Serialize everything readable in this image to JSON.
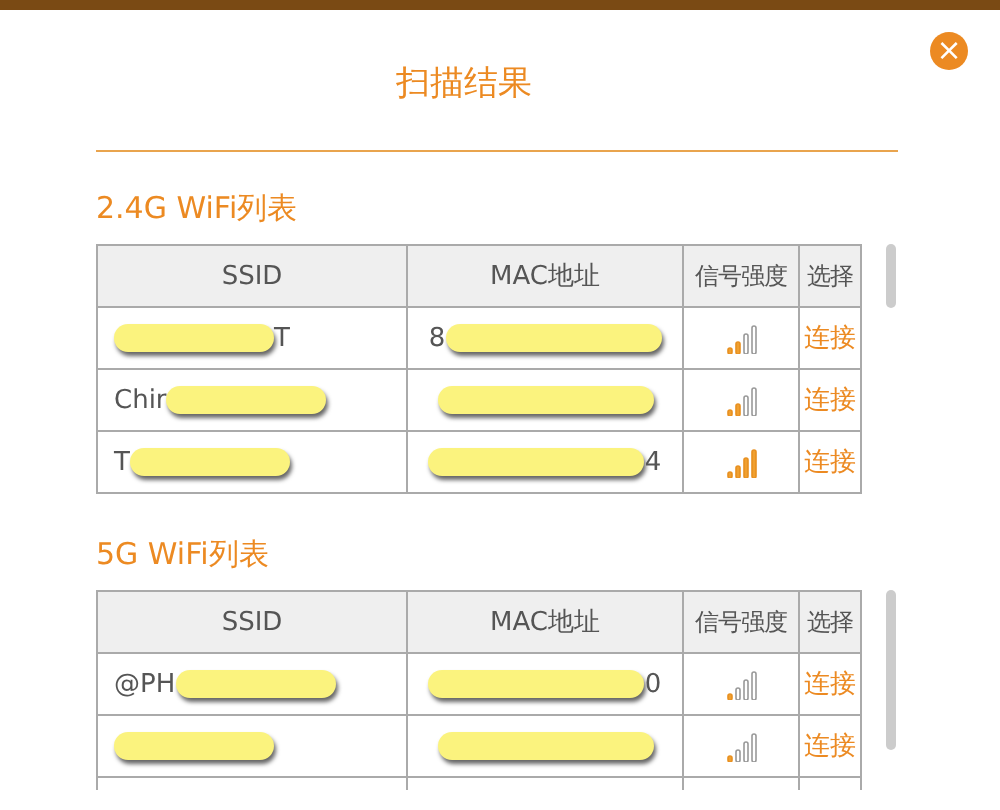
{
  "dialog": {
    "title": "扫描结果",
    "close": "×"
  },
  "sections": [
    {
      "title": "2.4G WiFi列表",
      "columns": [
        "SSID",
        "MAC地址",
        "信号强度",
        "选择"
      ],
      "rows": [
        {
          "ssid": {
            "after": "T"
          },
          "mac": {
            "before": "8"
          },
          "kind": "medium",
          "action": "连接"
        },
        {
          "ssid": {
            "before": "Chir"
          },
          "mac": {},
          "kind": "medium",
          "action": "连接"
        },
        {
          "ssid": {
            "before": "T"
          },
          "mac": {
            "after": "4"
          },
          "kind": "full",
          "action": "连接"
        }
      ]
    },
    {
      "title": "5G WiFi列表",
      "columns": [
        "SSID",
        "MAC地址",
        "信号强度",
        "选择"
      ],
      "rows": [
        {
          "ssid": {
            "before": "@PH"
          },
          "mac": {
            "after": "0"
          },
          "kind": "low",
          "action": "连接"
        },
        {
          "ssid": {},
          "mac": {},
          "kind": "low",
          "action": "连接"
        }
      ],
      "more_rows_below": true
    }
  ]
}
